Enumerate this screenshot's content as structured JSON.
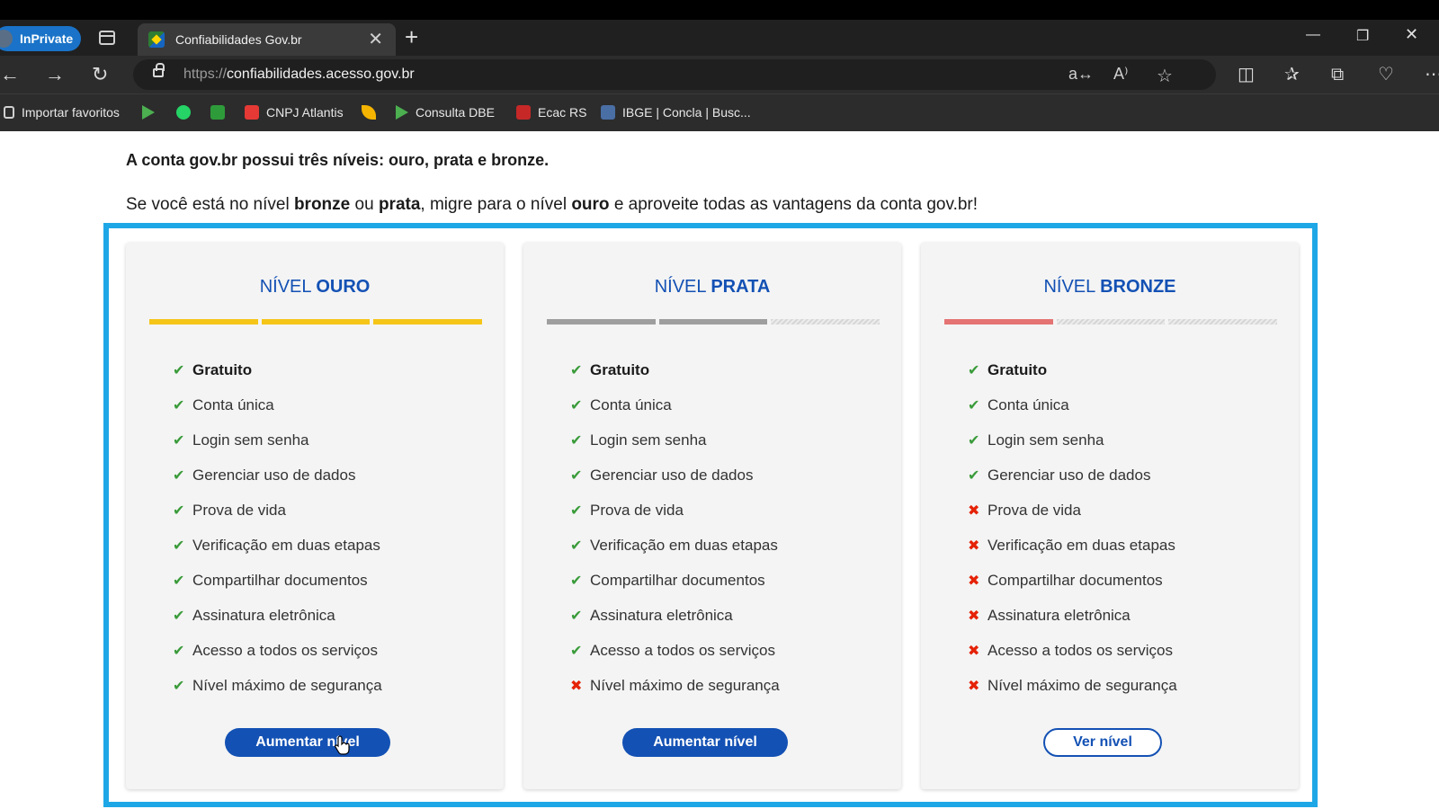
{
  "browser": {
    "inprivate_label": "InPrivate",
    "tab_title": "Confiabilidades Gov.br",
    "url_scheme": "https://",
    "url_host": "confiabilidades.acesso.gov.br",
    "bookmarks": [
      {
        "label": "Importar favoritos",
        "icon": "import-icon",
        "color": "#d0d0d0"
      },
      {
        "label": "",
        "icon": "arrow-bookmark-icon",
        "color": "#4caf50"
      },
      {
        "label": "",
        "icon": "whatsapp-icon",
        "color": "#25d366"
      },
      {
        "label": "",
        "icon": "gov-flag-icon",
        "color": "#2e9b3a"
      },
      {
        "label": "CNPJ Atlantis",
        "icon": "pdf-icon",
        "color": "#e53935"
      },
      {
        "label": "",
        "icon": "feather-icon",
        "color": "#f5b400"
      },
      {
        "label": "Consulta DBE",
        "icon": "arrow-bookmark-icon",
        "color": "#4caf50"
      },
      {
        "label": "Ecac RS",
        "icon": "sefaz-icon",
        "color": "#c62828"
      },
      {
        "label": "IBGE | Concla | Busc...",
        "icon": "ibge-icon",
        "color": "#4a6fa5"
      }
    ]
  },
  "page": {
    "headline": "A conta gov.br possui três níveis: ouro, prata e bronze.",
    "subline": {
      "part1": "Se você está no nível ",
      "bold1": "bronze",
      "part2": " ou ",
      "bold2": "prata",
      "part3": ", migre para o nível ",
      "bold3": "ouro",
      "part4": " e aproveite todas as vantagens da conta gov.br!"
    }
  },
  "levels": [
    {
      "title_prefix": "NÍVEL ",
      "title_level": "OURO",
      "filled_segments": 3,
      "bar_color": "gold",
      "button_label": "Aumentar nível",
      "button_style": "primary",
      "features": [
        {
          "label": "Gratuito",
          "included": true,
          "bold": true
        },
        {
          "label": "Conta única",
          "included": true
        },
        {
          "label": "Login sem senha",
          "included": true
        },
        {
          "label": "Gerenciar uso de dados",
          "included": true
        },
        {
          "label": "Prova de vida",
          "included": true
        },
        {
          "label": "Verificação em duas etapas",
          "included": true
        },
        {
          "label": "Compartilhar documentos",
          "included": true
        },
        {
          "label": "Assinatura eletrônica",
          "included": true
        },
        {
          "label": "Acesso a todos os serviços",
          "included": true
        },
        {
          "label": "Nível máximo de segurança",
          "included": true
        }
      ]
    },
    {
      "title_prefix": "NÍVEL ",
      "title_level": "PRATA",
      "filled_segments": 2,
      "bar_color": "silver",
      "button_label": "Aumentar nível",
      "button_style": "primary",
      "features": [
        {
          "label": "Gratuito",
          "included": true,
          "bold": true
        },
        {
          "label": "Conta única",
          "included": true
        },
        {
          "label": "Login sem senha",
          "included": true
        },
        {
          "label": "Gerenciar uso de dados",
          "included": true
        },
        {
          "label": "Prova de vida",
          "included": true
        },
        {
          "label": "Verificação em duas etapas",
          "included": true
        },
        {
          "label": "Compartilhar documentos",
          "included": true
        },
        {
          "label": "Assinatura eletrônica",
          "included": true
        },
        {
          "label": "Acesso a todos os serviços",
          "included": true
        },
        {
          "label": "Nível máximo de segurança",
          "included": false
        }
      ]
    },
    {
      "title_prefix": "NÍVEL ",
      "title_level": "BRONZE",
      "filled_segments": 1,
      "bar_color": "bronze",
      "button_label": "Ver nível",
      "button_style": "secondary",
      "features": [
        {
          "label": "Gratuito",
          "included": true,
          "bold": true
        },
        {
          "label": "Conta única",
          "included": true
        },
        {
          "label": "Login sem senha",
          "included": true
        },
        {
          "label": "Gerenciar uso de dados",
          "included": true
        },
        {
          "label": "Prova de vida",
          "included": false
        },
        {
          "label": "Verificação em duas etapas",
          "included": false
        },
        {
          "label": "Compartilhar documentos",
          "included": false
        },
        {
          "label": "Assinatura eletrônica",
          "included": false
        },
        {
          "label": "Acesso a todos os serviços",
          "included": false
        },
        {
          "label": "Nível máximo de segurança",
          "included": false
        }
      ]
    }
  ],
  "colors": {
    "gov_blue": "#1351b4",
    "highlight_border": "#1ea7e6",
    "check_green": "#3a9b3a",
    "cross_red": "#e52207"
  }
}
